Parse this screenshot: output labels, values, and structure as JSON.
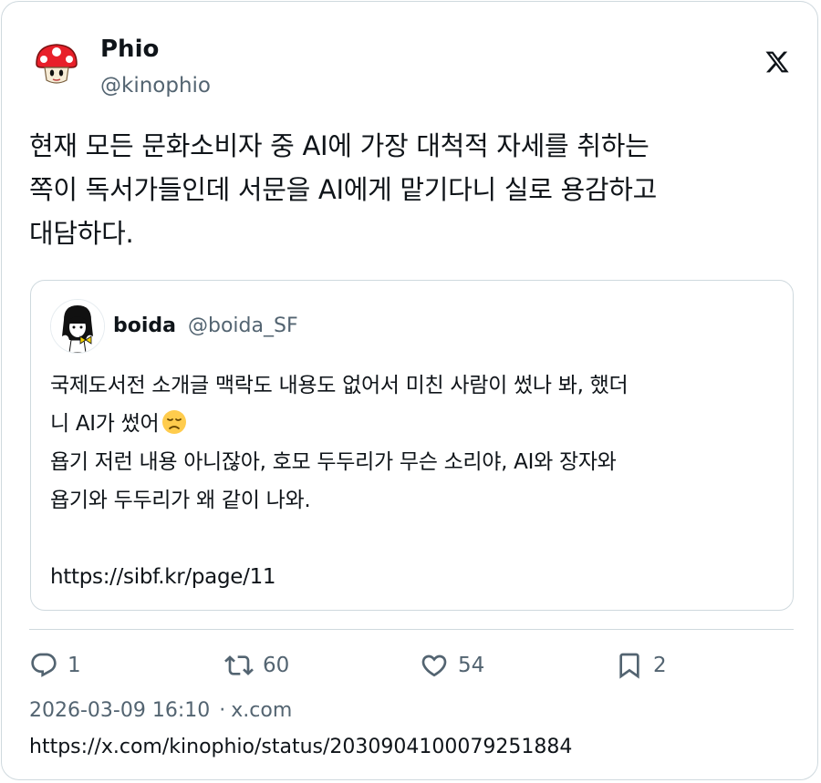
{
  "author": {
    "name": "Phio",
    "handle": "@kinophio",
    "avatar_icon": "mushroom-avatar-icon"
  },
  "logo_icon": "x-logo-icon",
  "tweet": {
    "lines": [
      "현재 모든 문화소비자 중 AI에 가장 대척적 자세를 취하는",
      "쪽이 독서가들인데 서문을 AI에게 맡기다니 실로 용감하고",
      "대담하다."
    ]
  },
  "quote": {
    "name": "boida",
    "handle": "@boida_SF",
    "avatar_icon": "girl-with-ribbon-avatar-icon",
    "lines": [
      "국제도서전 소개글 맥락도 내용도 없어서 미친 사람이 썼나 봐, 했더",
      "니 AI가 썼어",
      "욥기 저런 내용 아니잖아, 호모 두두리가 무슨 소리야, AI와 장자와",
      "욥기와 두두리가 왜 같이 나와.",
      "",
      "https://sibf.kr/page/11"
    ],
    "emoji": "disappointed-face-emoji"
  },
  "actions": {
    "replies": "1",
    "reposts": "60",
    "likes": "54",
    "bookmarks": "2"
  },
  "meta": {
    "timestamp": "2026-03-09 16:10",
    "separator": "·",
    "source": "x.com"
  },
  "link": "https://x.com/kinophio/status/2030904100079251884",
  "colors": {
    "text": "#0f1419",
    "secondary": "#536471",
    "border": "#cfd9de"
  }
}
